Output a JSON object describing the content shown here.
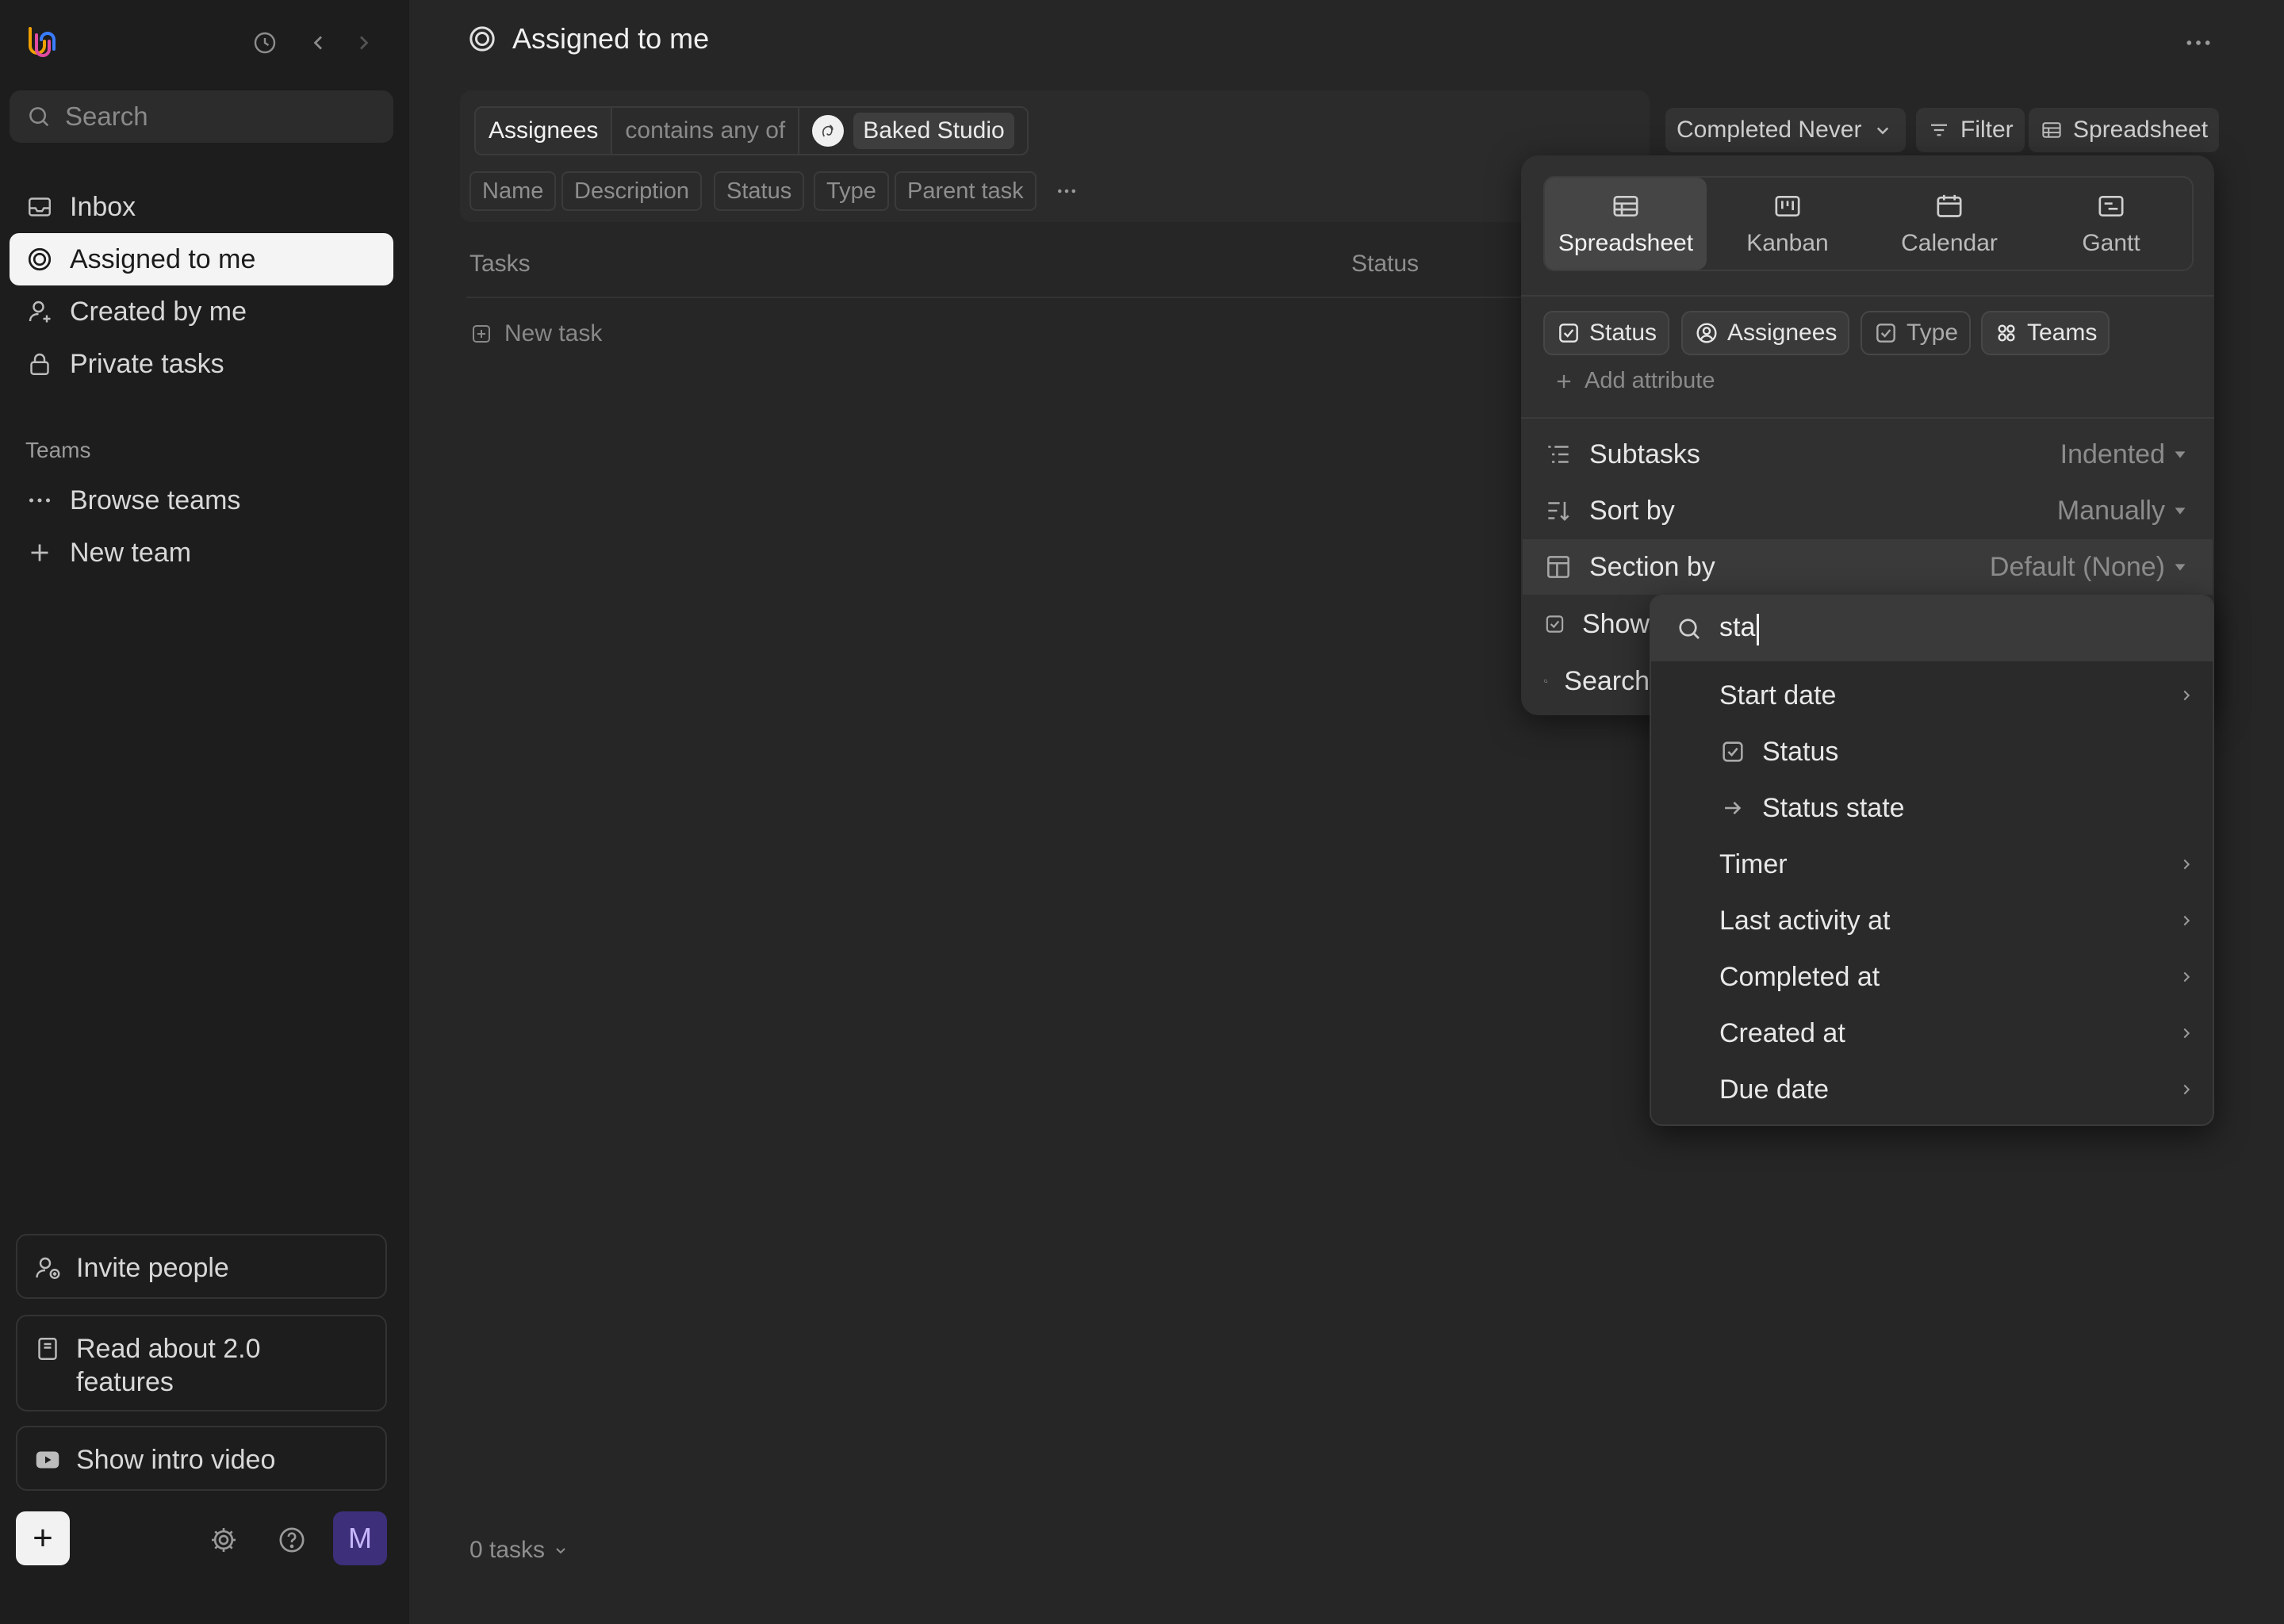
{
  "sidebar": {
    "search_placeholder": "Search",
    "nav": [
      {
        "label": "Inbox",
        "icon": "inbox-icon"
      },
      {
        "label": "Assigned to me",
        "icon": "target-icon",
        "active": true
      },
      {
        "label": "Created by me",
        "icon": "user-icon"
      },
      {
        "label": "Private tasks",
        "icon": "lock-icon"
      }
    ],
    "teams_label": "Teams",
    "team_items": [
      {
        "label": "Browse teams",
        "icon": "more-dots-icon"
      },
      {
        "label": "New team",
        "icon": "plus-icon"
      }
    ],
    "invite_label": "Invite people",
    "read_label": "Read about 2.0 features",
    "video_label": "Show intro video",
    "avatar_initial": "M",
    "add_label": "+"
  },
  "header": {
    "title": "Assigned to me"
  },
  "filter": {
    "field": "Assignees",
    "operator": "contains any of",
    "value": "Baked Studio"
  },
  "columns_chips": [
    "Name",
    "Description",
    "Status",
    "Type",
    "Parent task"
  ],
  "toolbar": {
    "completed": "Completed Never",
    "filter": "Filter",
    "view": "Spreadsheet"
  },
  "table": {
    "col_tasks": "Tasks",
    "col_status": "Status",
    "new_task": "New task",
    "count": "0 tasks"
  },
  "view_menu": {
    "tabs": [
      {
        "label": "Spreadsheet",
        "active": true
      },
      {
        "label": "Kanban"
      },
      {
        "label": "Calendar"
      },
      {
        "label": "Gantt"
      }
    ],
    "attributes": [
      {
        "label": "Status",
        "icon": "checkbox-icon",
        "on": true
      },
      {
        "label": "Assignees",
        "icon": "person-circle-icon",
        "on": true
      },
      {
        "label": "Type",
        "icon": "checkbox-icon",
        "on": false
      },
      {
        "label": "Teams",
        "icon": "grid-icon",
        "on": true
      }
    ],
    "add_attribute": "Add attribute",
    "options": [
      {
        "label": "Subtasks",
        "value": "Indented"
      },
      {
        "label": "Sort by",
        "value": "Manually"
      },
      {
        "label": "Section by",
        "value": "Default (None)"
      },
      {
        "label": "Show"
      },
      {
        "label": "Search"
      }
    ]
  },
  "section_dropdown": {
    "query": "sta",
    "items": [
      {
        "label": "Start date",
        "submenu": true
      },
      {
        "label": "Status",
        "icon": "checkbox-icon"
      },
      {
        "label": "Status state",
        "icon": "arrow-right-icon"
      },
      {
        "label": "Timer",
        "submenu": true
      },
      {
        "label": "Last activity at",
        "submenu": true
      },
      {
        "label": "Completed at",
        "submenu": true
      },
      {
        "label": "Created at",
        "submenu": true
      },
      {
        "label": "Due date",
        "submenu": true
      }
    ]
  }
}
